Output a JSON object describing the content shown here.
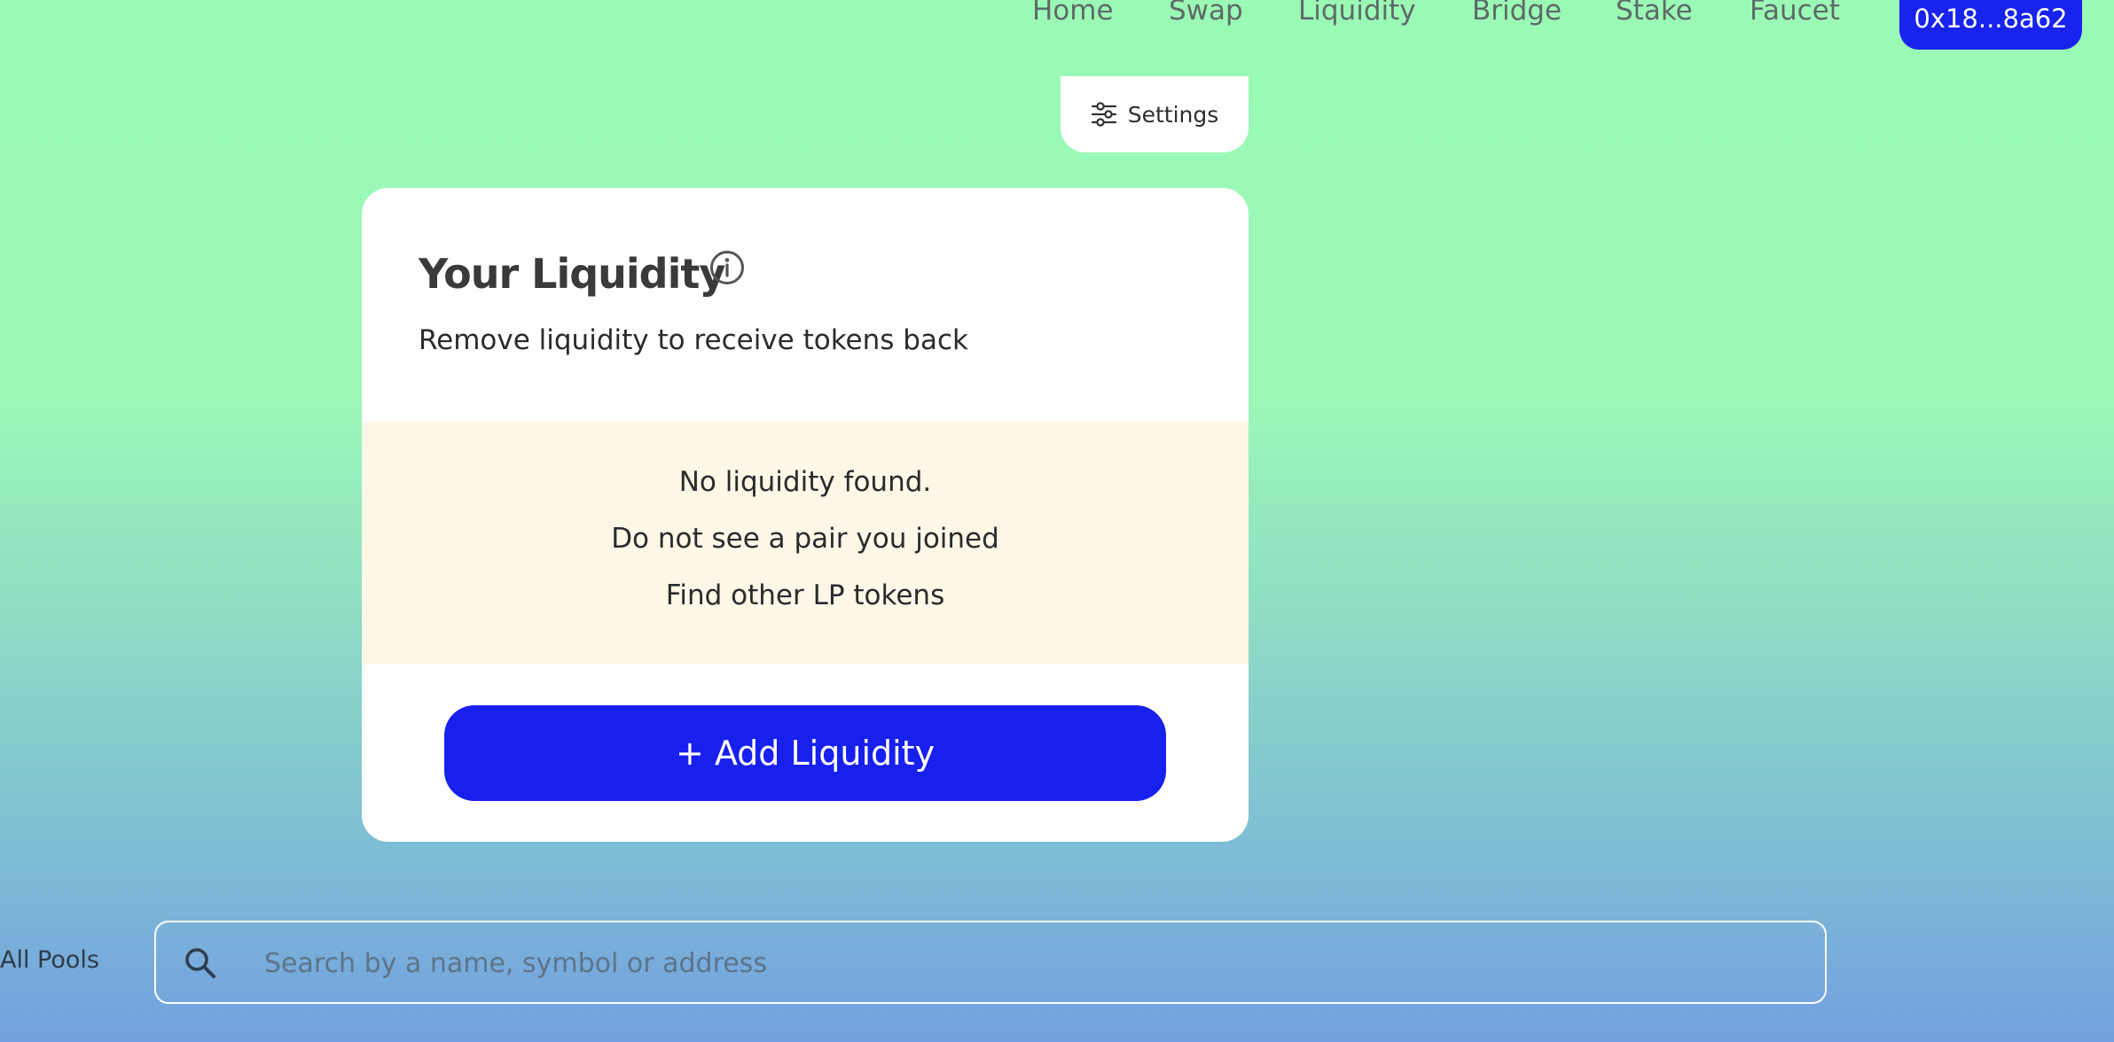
{
  "nav": {
    "links": [
      "Home",
      "Swap",
      "Liquidity",
      "Bridge",
      "Stake",
      "Faucet"
    ],
    "wallet_label": "0x18...8a62"
  },
  "settings": {
    "label": "Settings",
    "icon": "sliders-icon"
  },
  "liquidity_card": {
    "title": "Your Liquidity",
    "info_icon": "info-icon",
    "subtitle": "Remove liquidity to receive tokens back",
    "empty_state": {
      "line1": "No liquidity found.",
      "line2": "Do not see a pair you joined",
      "line3": "Find other LP tokens"
    },
    "add_button_label": "+ Add Liquidity"
  },
  "pools": {
    "tab_label": "All Pools",
    "search_placeholder": "Search by a name, symbol or address",
    "search_value": "",
    "search_icon": "magnifier-icon"
  },
  "colors": {
    "accent": "#1820ee",
    "empty_bg": "#fdf7e7",
    "background_top": "#9bf9b6",
    "background_bottom": "#73a0e0"
  }
}
